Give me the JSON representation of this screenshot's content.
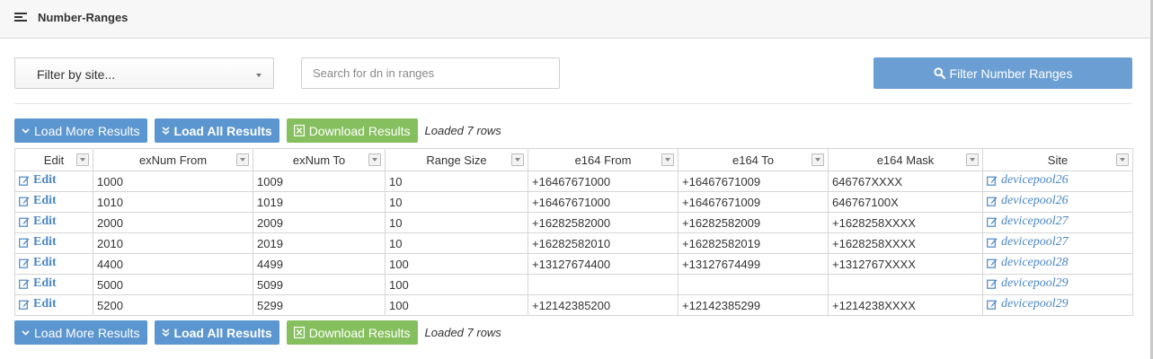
{
  "header": {
    "title": "Number-Ranges",
    "icon": "list-icon"
  },
  "filters": {
    "site_select_value": "Filter by site...",
    "search_placeholder": "Search for dn in ranges",
    "filter_button_label": "Filter Number Ranges"
  },
  "actions": {
    "load_more_label": "Load More Results",
    "load_all_label": "Load All Results",
    "download_label": "Download Results",
    "loaded_status": "Loaded 7 rows"
  },
  "colors": {
    "primary_button": "#5c96d0",
    "filter_button": "#6b9fd4",
    "download_button": "#86c05e",
    "link": "#4a86c5"
  },
  "table": {
    "columns": [
      "Edit",
      "exNum From",
      "exNum To",
      "Range Size",
      "e164 From",
      "e164 To",
      "e164 Mask",
      "Site"
    ],
    "rows": [
      {
        "edit": "Edit",
        "exnum_from": "1000",
        "exnum_to": "1009",
        "range_size": "10",
        "e164_from": "+16467671000",
        "e164_to": "+16467671009",
        "e164_mask": "646767XXXX",
        "site": "devicepool26"
      },
      {
        "edit": "Edit",
        "exnum_from": "1010",
        "exnum_to": "1019",
        "range_size": "10",
        "e164_from": "+16467671000",
        "e164_to": "+16467671009",
        "e164_mask": "646767100X",
        "site": "devicepool26"
      },
      {
        "edit": "Edit",
        "exnum_from": "2000",
        "exnum_to": "2009",
        "range_size": "10",
        "e164_from": "+16282582000",
        "e164_to": "+16282582009",
        "e164_mask": "+1628258XXXX",
        "site": "devicepool27"
      },
      {
        "edit": "Edit",
        "exnum_from": "2010",
        "exnum_to": "2019",
        "range_size": "10",
        "e164_from": "+16282582010",
        "e164_to": "+16282582019",
        "e164_mask": "+1628258XXXX",
        "site": "devicepool27"
      },
      {
        "edit": "Edit",
        "exnum_from": "4400",
        "exnum_to": "4499",
        "range_size": "100",
        "e164_from": "+13127674400",
        "e164_to": "+13127674499",
        "e164_mask": "+1312767XXXX",
        "site": "devicepool28"
      },
      {
        "edit": "Edit",
        "exnum_from": "5000",
        "exnum_to": "5099",
        "range_size": "100",
        "e164_from": "",
        "e164_to": "",
        "e164_mask": "",
        "site": "devicepool29"
      },
      {
        "edit": "Edit",
        "exnum_from": "5200",
        "exnum_to": "5299",
        "range_size": "100",
        "e164_from": "+12142385200",
        "e164_to": "+12142385299",
        "e164_mask": "+1214238XXXX",
        "site": "devicepool29"
      }
    ]
  }
}
